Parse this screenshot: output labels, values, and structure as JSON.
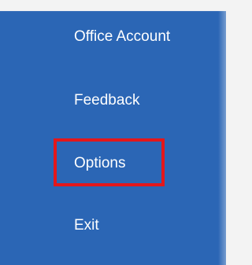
{
  "menu": {
    "items": [
      {
        "label": "Office Account"
      },
      {
        "label": "Feedback"
      },
      {
        "label": "Options",
        "highlighted": true
      },
      {
        "label": "Exit"
      }
    ]
  },
  "colors": {
    "background": "#2b66b5",
    "text": "#ffffff",
    "highlight": "#e3171b"
  }
}
